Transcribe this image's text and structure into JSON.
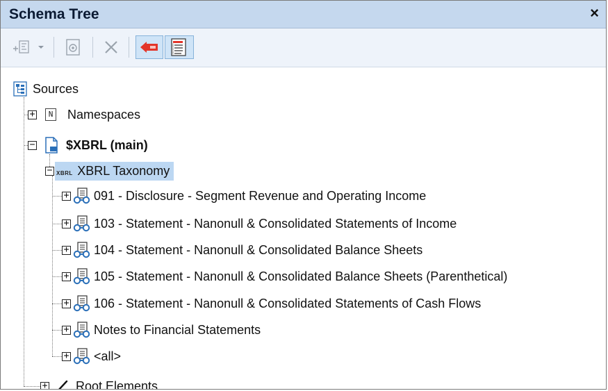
{
  "panel": {
    "title": "Schema Tree",
    "close_glyph": "×"
  },
  "toolbar": {
    "buttons": [
      {
        "name": "add-item-button",
        "icon": "add-item-icon"
      },
      {
        "name": "dropdown-arrow",
        "icon": "chevron-down-icon"
      },
      {
        "name": "properties-button",
        "icon": "properties-icon"
      },
      {
        "name": "delete-button",
        "icon": "delete-icon"
      },
      {
        "name": "show-source-button",
        "icon": "arrow-left-icon",
        "pressed": true
      },
      {
        "name": "show-tree-button",
        "icon": "tree-list-icon",
        "pressed": true
      }
    ]
  },
  "tree": {
    "root": {
      "label": "Sources",
      "icon": "sources-icon"
    },
    "namespaces": {
      "label": "Namespaces",
      "icon": "namespace-icon",
      "icon_letter": "N"
    },
    "main": {
      "label": "$XBRL (main)",
      "icon": "document-icon"
    },
    "taxonomy": {
      "label": "XBRL Taxonomy",
      "tag": "XBRL"
    },
    "items": [
      {
        "label": "091 - Disclosure - Segment Revenue and Operating Income"
      },
      {
        "label": "103 - Statement - Nanonull & Consolidated Statements of Income"
      },
      {
        "label": "104 - Statement - Nanonull & Consolidated Balance Sheets"
      },
      {
        "label": "105 - Statement - Nanonull & Consolidated Balance Sheets (Parenthetical)"
      },
      {
        "label": "106 - Statement - Nanonull & Consolidated Statements of Cash Flows"
      },
      {
        "label": "Notes to Financial Statements"
      },
      {
        "label": "<all>"
      }
    ],
    "root_elements": {
      "label": "Root Elements",
      "icon": "slash-icon"
    }
  },
  "colors": {
    "titlebar": "#c5d8ee",
    "toolbar": "#eef3fa",
    "selection": "#bcd7f2",
    "accent_red": "#d42a1e",
    "link_blue": "#2a6fb8"
  }
}
